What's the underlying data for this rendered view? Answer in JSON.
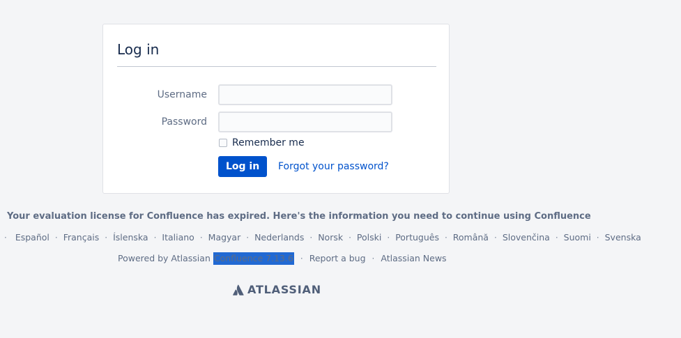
{
  "login": {
    "title": "Log in",
    "username_label": "Username",
    "username_value": "",
    "password_label": "Password",
    "password_value": "",
    "remember_label": "Remember me",
    "remember_checked": false,
    "submit_label": "Log in",
    "forgot_label": "Forgot your password?"
  },
  "license_notice": "Your evaluation license for Confluence has expired. Here's the information you need to continue using Confluence",
  "languages": [
    "Español",
    "Français",
    "Íslenska",
    "Italiano",
    "Magyar",
    "Nederlands",
    "Norsk",
    "Polski",
    "Português",
    "Română",
    "Slovenčina",
    "Suomi",
    "Svenska"
  ],
  "footer": {
    "powered_by": "Powered by Atlassian",
    "product_version": "Confluence 7.13.6",
    "report_bug": "Report a bug",
    "news": "Atlassian News"
  },
  "logo": {
    "wordmark": "ATLASSIAN",
    "icon": "atlassian-logo-icon"
  },
  "colors": {
    "background": "#f4f5f7",
    "primary": "#0052cc",
    "text_subtle": "#5e6c84",
    "selection": "#2169d3"
  }
}
